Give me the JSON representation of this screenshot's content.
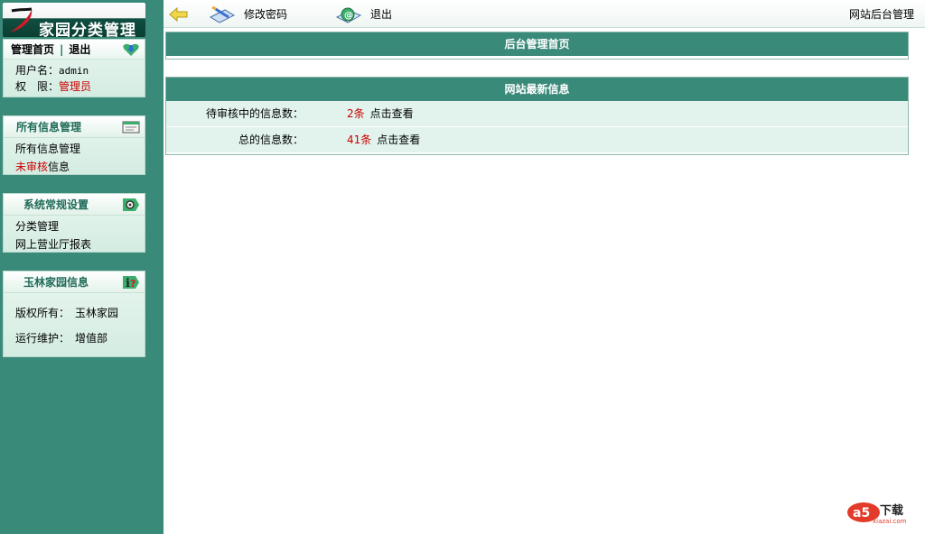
{
  "app": {
    "logo_text": "家园分类管理"
  },
  "topbar": {
    "change_password": "修改密码",
    "logout": "退出",
    "site_admin": "网站后台管理"
  },
  "user_panel": {
    "home": "管理首页",
    "separator": "|",
    "logout": "退出",
    "username_label": "用户名：",
    "username": "admin",
    "role_label": "权　限：",
    "role": "管理员"
  },
  "sidebar": {
    "info_manage": {
      "title": "所有信息管理",
      "items": [
        {
          "label": "所有信息管理"
        },
        {
          "label_red": "未审核",
          "label": "信息"
        }
      ]
    },
    "system": {
      "title": "系统常规设置",
      "items": [
        {
          "label": "分类管理"
        },
        {
          "label": "网上营业厅报表"
        }
      ]
    },
    "about": {
      "title": "玉林家园信息",
      "items": [
        {
          "label": "版权所有：",
          "value": "玉林家园"
        },
        {
          "label": "运行维护：",
          "value": "增值部"
        }
      ]
    }
  },
  "main": {
    "home_box": {
      "title": "后台管理首页"
    },
    "latest_box": {
      "title": "网站最新信息",
      "rows": [
        {
          "label": "待审核中的信息数：",
          "count": "2条",
          "link": "点击查看"
        },
        {
          "label": "总的信息数：",
          "count": "41条",
          "link": "点击查看"
        }
      ]
    }
  },
  "watermark": {
    "logo": "a5",
    "text": "下载",
    "url": "xiazai.com"
  },
  "colors": {
    "sidebar_bg": "#3a8a7a",
    "header_bg": "#3a8a7a",
    "accent_red": "#cc0000"
  }
}
